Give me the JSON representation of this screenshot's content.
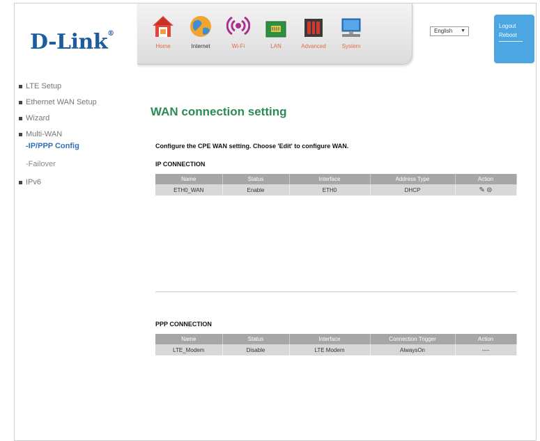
{
  "brand": {
    "logo": "D-Link",
    "reg": "®"
  },
  "nav": [
    {
      "label": "Home",
      "icon": "house-icon"
    },
    {
      "label": "Internet",
      "icon": "globe-icon"
    },
    {
      "label": "Wi-Fi",
      "icon": "wifi-icon"
    },
    {
      "label": "LAN",
      "icon": "network-card-icon"
    },
    {
      "label": "Advanced",
      "icon": "toolbox-icon"
    },
    {
      "label": "System",
      "icon": "computer-icon"
    }
  ],
  "language": {
    "selected": "English"
  },
  "account": {
    "logout": "Logout",
    "reboot": "Reboot"
  },
  "sidebar": {
    "items": [
      "LTE Setup",
      "Ethernet WAN Setup",
      "Wizard",
      "Multi-WAN"
    ],
    "sub": [
      "-IP/PPP Config",
      "-Failover"
    ],
    "ipv6": "IPv6"
  },
  "main": {
    "title": "WAN connection setting",
    "description": "Configure the CPE WAN setting. Choose 'Edit' to configure WAN.",
    "ip": {
      "title": "IP CONNECTION",
      "headers": [
        "Name",
        "Status",
        "Interface",
        "Address Type",
        "Action"
      ],
      "row": [
        "ETH0_WAN",
        "Enable",
        "ETH0",
        "DHCP"
      ]
    },
    "ppp": {
      "title": "PPP CONNECTION",
      "headers": [
        "Name",
        "Status",
        "Interface",
        "Connection Trigger",
        "Action"
      ],
      "row": [
        "LTE_Modem",
        "Disable",
        "LTE Modem",
        "AlwaysOn",
        "----"
      ]
    }
  }
}
